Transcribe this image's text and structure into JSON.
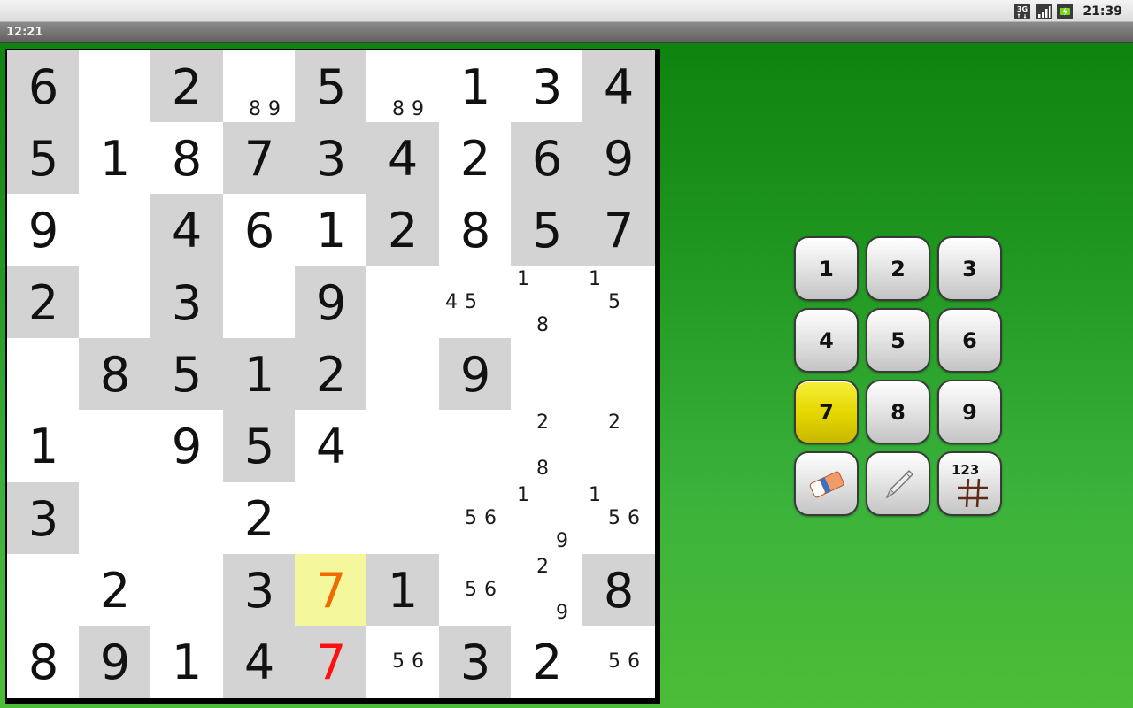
{
  "status_bar": {
    "time": "21:39",
    "network_label": "3G",
    "icons": [
      "network-3g-icon",
      "signal-strength-icon",
      "battery-icon"
    ]
  },
  "title_bar": {
    "time": "12:21"
  },
  "colors": {
    "given_cell": "#d3d3d3",
    "empty_cell": "#ffffff",
    "selected_cell": "#f5f79c",
    "selected_digit": "#f06a00",
    "conflict_digit": "#ff1010",
    "active_key": "#e6d800",
    "background_green": "#2a9f2a"
  },
  "board": {
    "digits": [
      [
        "6",
        "",
        "2",
        "",
        "5",
        "",
        "1",
        "3",
        "4"
      ],
      [
        "5",
        "1",
        "8",
        "7",
        "3",
        "4",
        "2",
        "6",
        "9"
      ],
      [
        "9",
        "",
        "4",
        "6",
        "1",
        "2",
        "8",
        "5",
        "7"
      ],
      [
        "2",
        "",
        "3",
        "",
        "9",
        "",
        "",
        "",
        ""
      ],
      [
        "",
        "8",
        "5",
        "1",
        "2",
        "",
        "9",
        "",
        ""
      ],
      [
        "1",
        "",
        "9",
        "5",
        "4",
        "",
        "",
        "",
        ""
      ],
      [
        "3",
        "",
        "",
        "2",
        "",
        "",
        "",
        "",
        ""
      ],
      [
        "",
        "2",
        "",
        "3",
        "7",
        "1",
        "",
        "",
        "8"
      ],
      [
        "8",
        "9",
        "1",
        "4",
        "7",
        "",
        "3",
        "2",
        ""
      ]
    ],
    "given": [
      [
        1,
        0,
        1,
        0,
        1,
        0,
        0,
        0,
        1
      ],
      [
        1,
        0,
        0,
        1,
        1,
        1,
        0,
        1,
        1
      ],
      [
        0,
        0,
        1,
        0,
        0,
        1,
        0,
        1,
        1
      ],
      [
        1,
        0,
        1,
        0,
        1,
        0,
        0,
        0,
        0
      ],
      [
        0,
        1,
        1,
        1,
        1,
        0,
        1,
        0,
        0
      ],
      [
        0,
        0,
        0,
        1,
        0,
        0,
        0,
        0,
        0
      ],
      [
        1,
        0,
        0,
        0,
        0,
        0,
        0,
        0,
        0
      ],
      [
        0,
        0,
        0,
        1,
        0,
        1,
        0,
        0,
        1
      ],
      [
        0,
        1,
        0,
        1,
        1,
        0,
        1,
        0,
        0
      ]
    ],
    "notes": [
      [
        [],
        [],
        [],
        [
          "8",
          "9"
        ],
        [],
        [
          "8",
          "9"
        ],
        [],
        [],
        []
      ],
      [
        [],
        [],
        [],
        [],
        [],
        [],
        [],
        [],
        []
      ],
      [
        [],
        [],
        [],
        [],
        [],
        [],
        [],
        [],
        []
      ],
      [
        [],
        [],
        [],
        [],
        [],
        [],
        [
          "4",
          "5"
        ],
        [
          "1",
          "8"
        ],
        [
          "1",
          "5"
        ]
      ],
      [
        [],
        [],
        [],
        [],
        [],
        [],
        [],
        [],
        []
      ],
      [
        [],
        [],
        [],
        [],
        [],
        [],
        [],
        [
          "2",
          "8"
        ],
        [
          "2"
        ]
      ],
      [
        [],
        [],
        [],
        [],
        [],
        [],
        [
          "5",
          "6"
        ],
        [
          "1",
          "9"
        ],
        [
          "1",
          "5",
          "6"
        ]
      ],
      [
        [],
        [],
        [],
        [],
        [],
        [],
        [
          "5",
          "6"
        ],
        [
          "2",
          "9"
        ],
        []
      ],
      [
        [],
        [],
        [],
        [],
        [],
        [
          "5",
          "6"
        ],
        [],
        [],
        [
          "5",
          "6"
        ]
      ]
    ],
    "selected_cell": [
      7,
      4
    ],
    "selected_digit_cells": [
      [
        7,
        4
      ]
    ],
    "conflict_digit_cells": [
      [
        8,
        4
      ]
    ]
  },
  "keypad": {
    "keys": [
      "1",
      "2",
      "3",
      "4",
      "5",
      "6",
      "7",
      "8",
      "9"
    ],
    "active_key": "7",
    "tools": [
      {
        "name": "eraser",
        "icon": "eraser-icon"
      },
      {
        "name": "pencil",
        "icon": "pencil-icon"
      },
      {
        "name": "notes-grid",
        "icon": "notes-grid-icon",
        "label": "123"
      }
    ]
  }
}
